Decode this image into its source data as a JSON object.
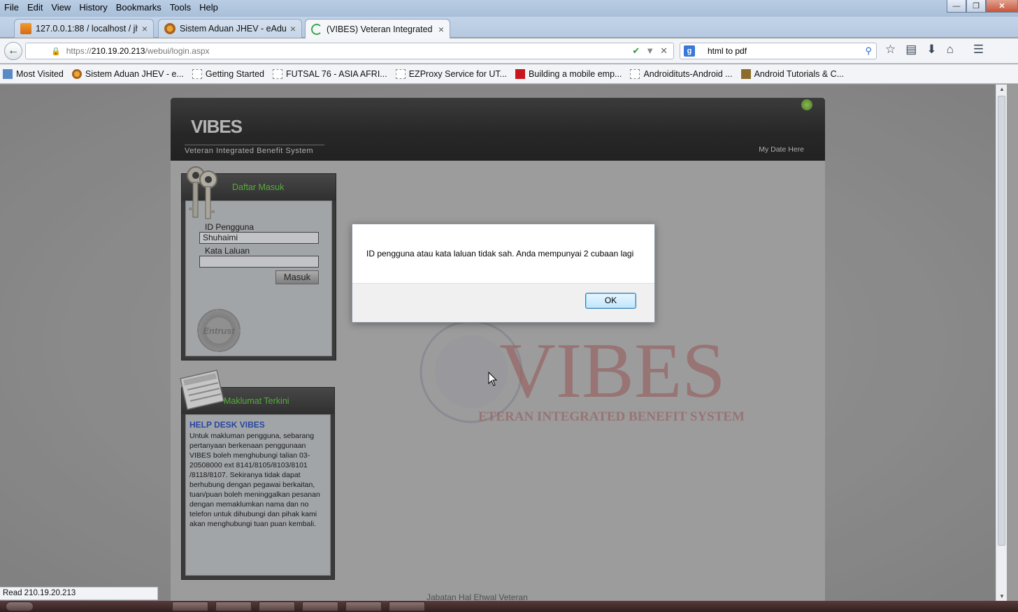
{
  "menu": [
    "File",
    "Edit",
    "View",
    "History",
    "Bookmarks",
    "Tools",
    "Help"
  ],
  "tabs": [
    {
      "label": "127.0.0.1:88 / localhost / jh...",
      "close": "×"
    },
    {
      "label": "Sistem Aduan JHEV - eAdu...",
      "close": "×"
    },
    {
      "label": "(VIBES) Veteran Integrated ...",
      "close": "×"
    }
  ],
  "new_tab": "+",
  "address": {
    "prefix": "https://",
    "host": "210.19.20.213",
    "path": "/webui/login.aspx"
  },
  "search": {
    "engine": "g",
    "value": "html to pdf"
  },
  "bookmarks": [
    {
      "label": "Most Visited",
      "icon": "most-visited-icon"
    },
    {
      "label": "Sistem Aduan JHEV - e...",
      "icon": "jhev-icon"
    },
    {
      "label": "Getting Started",
      "icon": "blank-page-icon"
    },
    {
      "label": "FUTSAL 76 - ASIA AFRI...",
      "icon": "blank-page-icon"
    },
    {
      "label": "EZProxy Service for UT...",
      "icon": "blank-page-icon"
    },
    {
      "label": "Building a mobile emp...",
      "icon": "adobe-icon"
    },
    {
      "label": "Androidituts-Android ...",
      "icon": "blank-page-icon"
    },
    {
      "label": "Android Tutorials & C...",
      "icon": "android-tutorials-icon"
    }
  ],
  "site": {
    "title": "VIBES",
    "subtitle": "Veteran Integrated Benefit System",
    "date": "My Date Here",
    "login": {
      "title": "Daftar Masuk",
      "user_label": "ID Pengguna",
      "user_value": "Shuhaimi",
      "pass_label": "Kata Laluan",
      "pass_value": "",
      "submit": "Masuk",
      "seal_text": "Entrust"
    },
    "news": {
      "title": "Maklumat Terkini",
      "headline": "HELP DESK VIBES",
      "body": "Untuk makluman pengguna, sebarang pertanyaan berkenaan penggunaan VIBES boleh menghubungi talian 03-20508000 ext 8141/8105/8103/8101 /8118/8107. Sekiranya tidak dapat berhubung dengan pegawai berkaitan, tuan/puan boleh meninggalkan pesanan dengan memaklumkan nama dan no telefon untuk dihubungi dan pihak kami akan menghubungi tuan puan kembali."
    },
    "footer": "Jabatan Hal Ehwal Veteran"
  },
  "dialog": {
    "message": "ID pengguna atau kata laluan tidak sah. Anda mempunyai 2 cubaan lagi",
    "ok": "OK"
  },
  "status": "Read 210.19.20.213",
  "colors": {
    "accent_green": "#5dc43e",
    "news_headline": "#2347b8",
    "header_dark": "#222222"
  }
}
